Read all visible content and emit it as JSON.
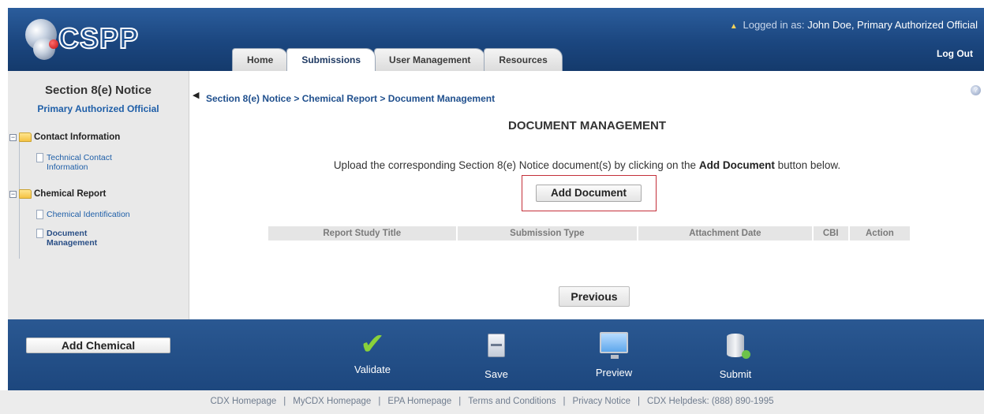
{
  "header": {
    "logo_text": "CSPP",
    "login_prefix": "Logged in as:",
    "login_user": "John Doe, Primary Authorized Official",
    "logout": "Log Out",
    "tabs": [
      {
        "label": "Home"
      },
      {
        "label": "Submissions"
      },
      {
        "label": "User Management"
      },
      {
        "label": "Resources"
      }
    ],
    "active_tab": "Submissions"
  },
  "sidebar": {
    "title": "Section 8(e) Notice",
    "subtitle": "Primary Authorized Official",
    "groups": [
      {
        "label": "Contact Information",
        "items": [
          "Technical Contact Information"
        ]
      },
      {
        "label": "Chemical Report",
        "items": [
          "Chemical Identification",
          "Document Management"
        ]
      }
    ]
  },
  "main": {
    "breadcrumb": "Section 8(e) Notice > Chemical Report > Document Management",
    "title": "DOCUMENT MANAGEMENT",
    "instruction_prefix": "Upload the corresponding Section 8(e) Notice document(s) by clicking on the",
    "instruction_bold": "Add Document",
    "instruction_suffix": "button below.",
    "add_document": "Add Document",
    "table_headers": [
      "Report Study Title",
      "Submission Type",
      "Attachment Date",
      "CBI",
      "Action"
    ],
    "previous": "Previous"
  },
  "action_bar": {
    "add_chemical": "Add Chemical",
    "actions": [
      {
        "label": "Validate",
        "icon": "checkmark-icon"
      },
      {
        "label": "Save",
        "icon": "save-icon"
      },
      {
        "label": "Preview",
        "icon": "monitor-icon"
      },
      {
        "label": "Submit",
        "icon": "database-icon"
      }
    ]
  },
  "footer": {
    "links": [
      "CDX Homepage",
      "MyCDX Homepage",
      "EPA Homepage",
      "Terms and Conditions",
      "Privacy Notice",
      "CDX Helpdesk: (888) 890-1995"
    ]
  },
  "colors": {
    "header_blue": "#1b467f",
    "link_blue": "#1f5fa8",
    "highlight_red": "#c4303a",
    "validate_green": "#8ad13a"
  }
}
